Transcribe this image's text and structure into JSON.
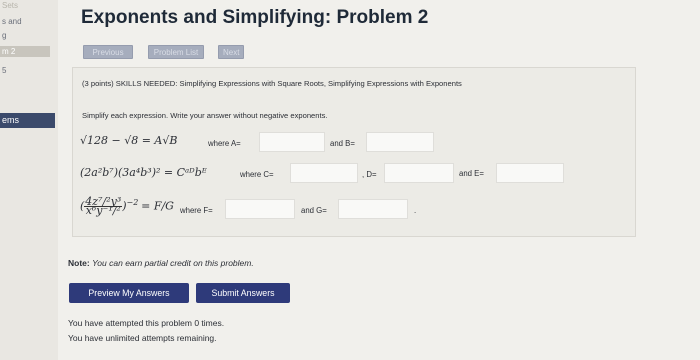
{
  "sidebar": {
    "top_item": "Sets",
    "item_and": "s and",
    "item_g": "g",
    "badge": "m 2",
    "item_5": "5",
    "active": "ems"
  },
  "page": {
    "title": "Exponents and Simplifying: Problem 2"
  },
  "nav": {
    "previous_label": "Previous",
    "problem_list_label": "Problem List",
    "next_label": "Next"
  },
  "problem": {
    "header": "(3 points) SKILLS NEEDED: Simplifying Expressions with Square Roots, Simplifying Expressions with Exponents",
    "instructions": "Simplify each expression. Write your answer without negative exponents.",
    "row1": {
      "lhs": "√128 − √8 = A√B",
      "where_a": "where A=",
      "and_b": "and B="
    },
    "row2": {
      "lhs": "(2a²b⁷)(3a⁴b³)² = Cᵃᴰbᴱ",
      "where_c": "where C=",
      "comma_d": ", D=",
      "and_e": "and E="
    },
    "row3": {
      "frac_num": "4z⁷/²y³",
      "frac_den": "x⁶y⁻¹/²",
      "exp": "−2",
      "eq": "= F/G",
      "where_f": "where F=",
      "and_g": "and G=",
      "trail": "."
    },
    "answers": {
      "A": "",
      "B": "",
      "C": "",
      "D": "",
      "E": "",
      "F": "",
      "G": ""
    }
  },
  "note": {
    "bold": "Note:",
    "text": "You can earn partial credit on this problem."
  },
  "buttons": {
    "preview": "Preview My Answers",
    "submit": "Submit Answers"
  },
  "status": {
    "attempts": "You have attempted this problem 0 times.",
    "remaining": "You have unlimited attempts remaining."
  },
  "colors": {
    "button_bg": "#2e3a7a",
    "sidebar_active": "#3b4a6b"
  }
}
